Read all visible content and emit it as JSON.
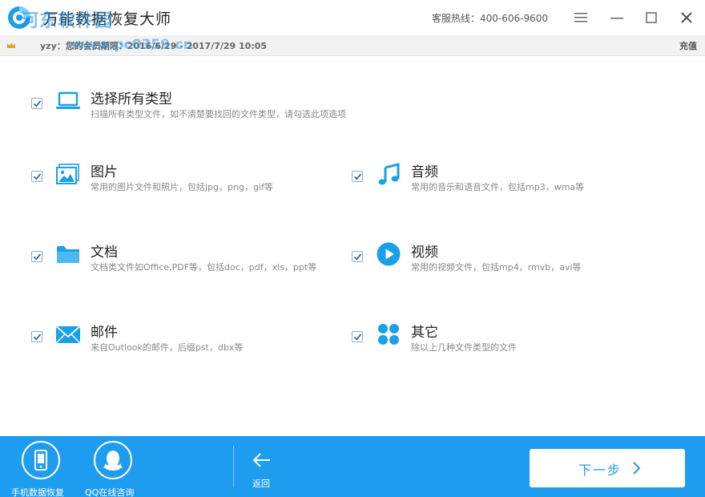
{
  "window": {
    "title": "万能数据恢复大师",
    "hotline": "客服热线：400-606-9600"
  },
  "infobar": {
    "user_text": "yzy：您的会员期限：2016/6/29 - 2017/7/29 10:05",
    "recharge": "充值"
  },
  "watermark": {
    "text": "河东软件园",
    "url": "www.pc0359.cn"
  },
  "options": {
    "all": {
      "title": "选择所有类型",
      "desc": "扫描所有类型文件，如不清楚要找回的文件类型，请勾选此项选项",
      "checked": true,
      "icon": "laptop-icon"
    },
    "images": {
      "title": "图片",
      "desc": "常用的图片文件和照片，包括jpg，png，gif等",
      "checked": true,
      "icon": "image-icon"
    },
    "audio": {
      "title": "音频",
      "desc": "常用的音乐和语音文件，包括mp3，wma等",
      "checked": true,
      "icon": "music-note-icon"
    },
    "docs": {
      "title": "文档",
      "desc": "文档类文件如Office,PDF等，包括doc，pdf，xls，ppt等",
      "checked": true,
      "icon": "folder-icon"
    },
    "video": {
      "title": "视频",
      "desc": "常用的视频文件，包括mp4，rmvb，avi等",
      "checked": true,
      "icon": "play-icon"
    },
    "mail": {
      "title": "邮件",
      "desc": "来自Outlook的邮件，后缀pst，dbx等",
      "checked": true,
      "icon": "envelope-icon"
    },
    "other": {
      "title": "其它",
      "desc": "除以上几种文件类型的文件",
      "checked": true,
      "icon": "grid-icon"
    }
  },
  "footer": {
    "phone_recovery": "手机数据恢复",
    "qq_support": "QQ在线咨询",
    "back": "返回",
    "next": "下一步"
  },
  "colors": {
    "accent": "#1e9cf0",
    "icon_blue": "#1aa0e8"
  }
}
